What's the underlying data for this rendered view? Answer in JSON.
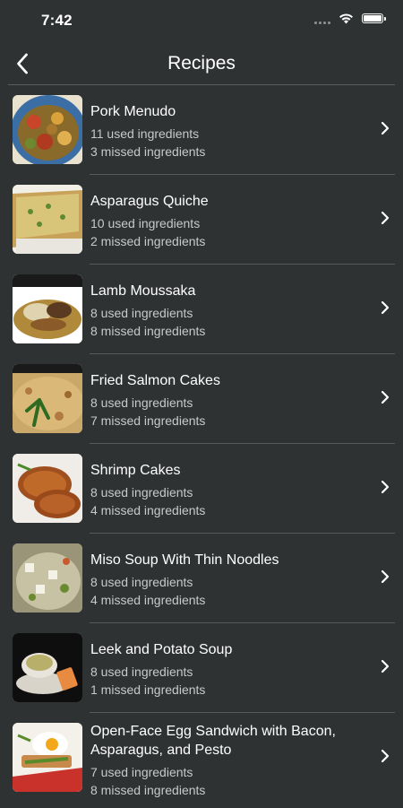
{
  "status_bar": {
    "time": "7:42"
  },
  "nav": {
    "title": "Recipes"
  },
  "recipes": [
    {
      "name": "Pork Menudo",
      "used": "11 used ingredients",
      "missed": "3 missed ingredients"
    },
    {
      "name": "Asparagus Quiche",
      "used": "10 used ingredients",
      "missed": "2 missed ingredients"
    },
    {
      "name": "Lamb Moussaka",
      "used": "8 used ingredients",
      "missed": "8 missed ingredients"
    },
    {
      "name": "Fried Salmon Cakes",
      "used": "8 used ingredients",
      "missed": "7 missed ingredients"
    },
    {
      "name": "Shrimp Cakes",
      "used": "8 used ingredients",
      "missed": "4 missed ingredients"
    },
    {
      "name": "Miso Soup With Thin Noodles",
      "used": "8 used ingredients",
      "missed": "4 missed ingredients"
    },
    {
      "name": "Leek and Potato Soup",
      "used": "8 used ingredients",
      "missed": "1 missed ingredients"
    },
    {
      "name": "Open-Face Egg Sandwich with Bacon, Asparagus, and Pesto",
      "used": "7 used ingredients",
      "missed": "8 missed ingredients"
    }
  ],
  "colors": {
    "background": "#2f3233",
    "text_secondary": "#c7c9ca",
    "divider": "#55595b"
  },
  "icons": {
    "back": "chevron-left-icon",
    "row": "chevron-right-icon",
    "wifi": "wifi-icon",
    "battery": "battery-icon"
  }
}
